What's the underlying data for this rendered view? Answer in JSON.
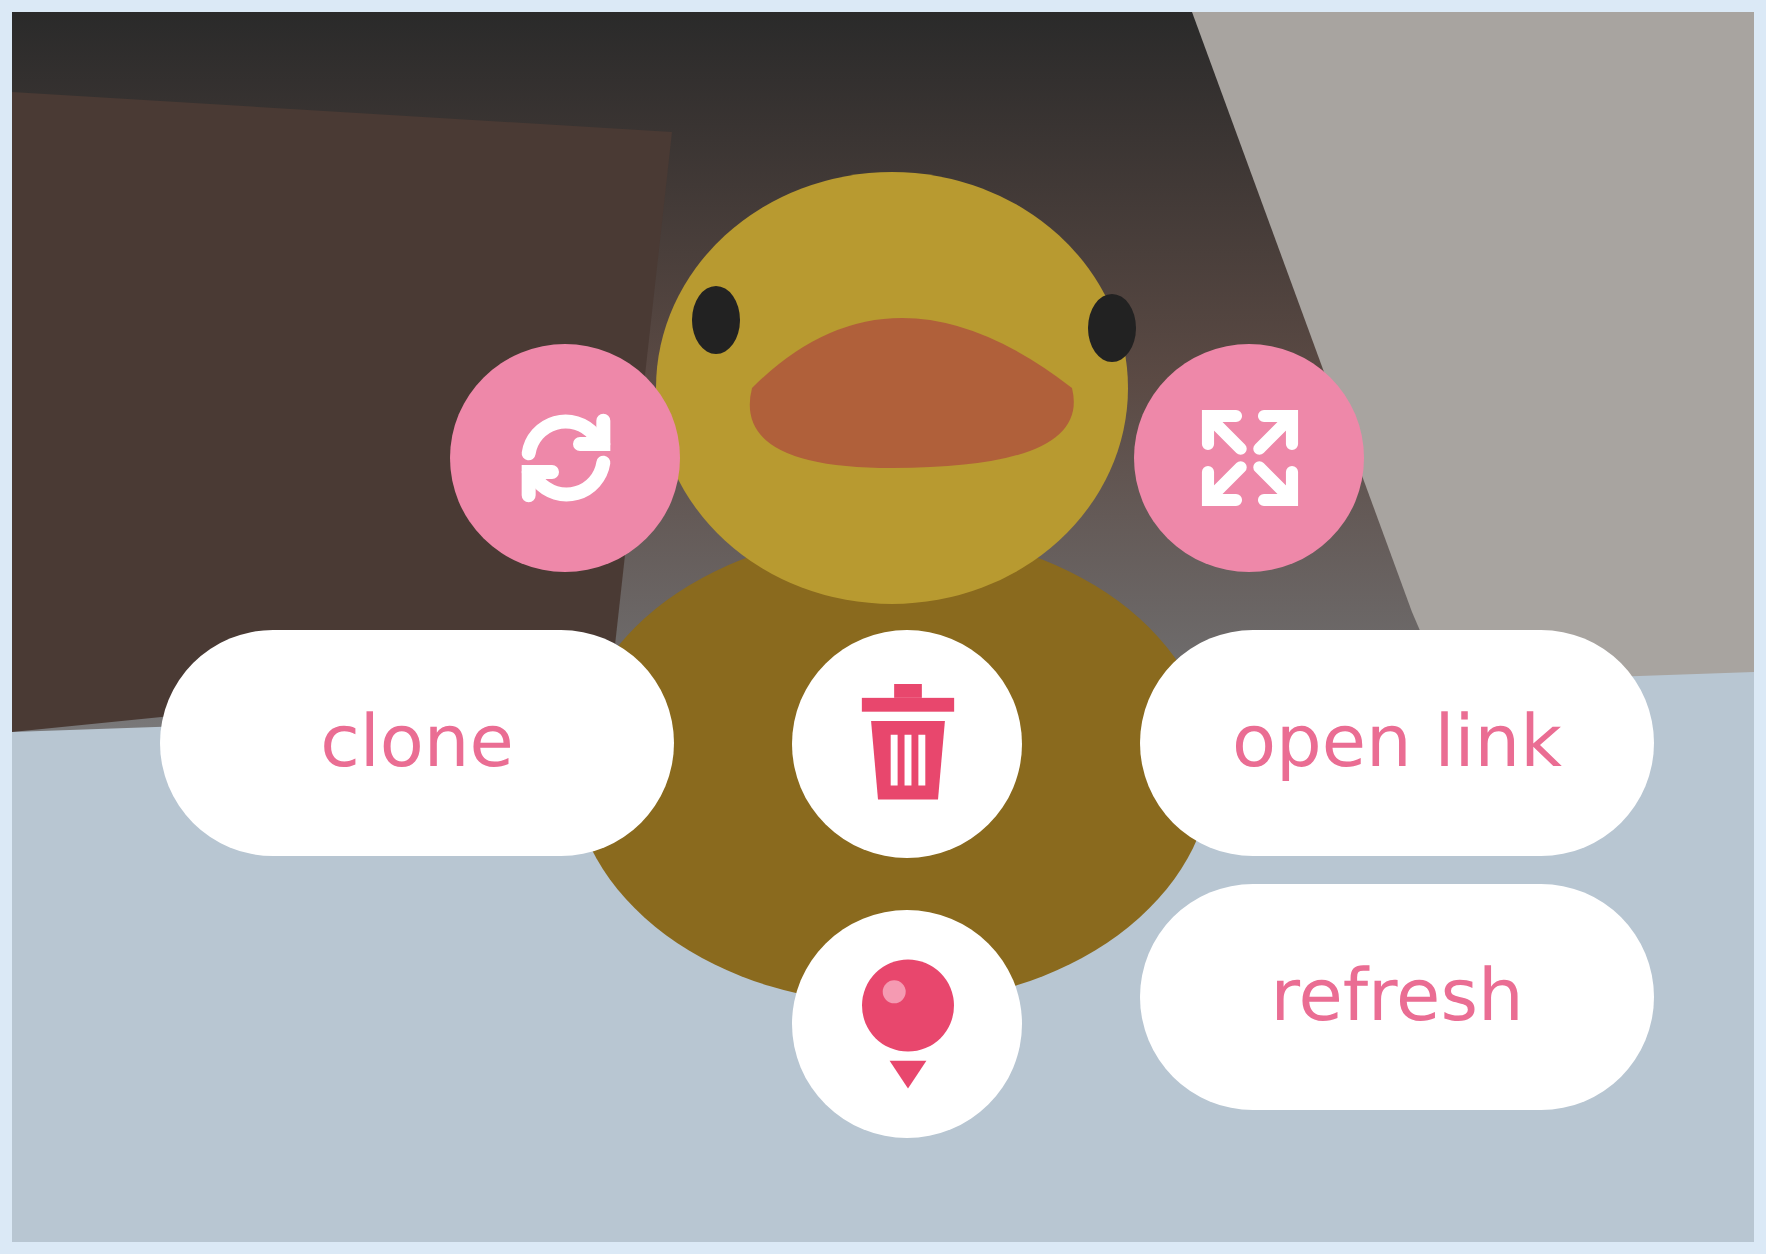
{
  "object_menu": {
    "text_buttons": [
      {
        "label": "clone"
      },
      {
        "label": "open link"
      },
      {
        "label": "refresh"
      }
    ]
  }
}
